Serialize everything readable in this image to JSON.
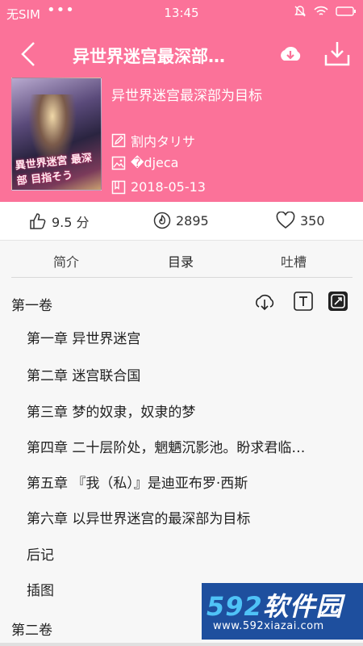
{
  "status_bar": {
    "carrier": "无SIM",
    "dots": "•••",
    "time": "13:45"
  },
  "header": {
    "title": "异世界迷宫最深部…",
    "book_name": "异世界迷宫最深部为目标",
    "author": "割内タリサ",
    "illustrator": "�djeca",
    "date": "2018-05-13",
    "cover_text": "異世界迷宮 最深部 目指そう",
    "colors": {
      "header_bg": "#fb7299"
    }
  },
  "stats": {
    "rating": "9.5 分",
    "hot": "2895",
    "favorites": "350"
  },
  "tabs": [
    "简介",
    "目录",
    "吐槽"
  ],
  "volumes": [
    {
      "title": "第一卷",
      "chapters": [
        "第一章 异世界迷宫",
        "第二章 迷宫联合国",
        "第三章 梦的奴隶，奴隶的梦",
        "第四章 二十层阶处，魍魉沉影池。盼求君临…",
        "第五章 『我（私）』是迪亚布罗·西斯",
        "第六章 以异世界迷宫的最深部为目标",
        "后记",
        "插图"
      ]
    },
    {
      "title": "第二卷",
      "chapters": []
    }
  ],
  "watermark": {
    "big_num": "592",
    "big_text": "软件园",
    "url": "www.592xiazai.com"
  }
}
